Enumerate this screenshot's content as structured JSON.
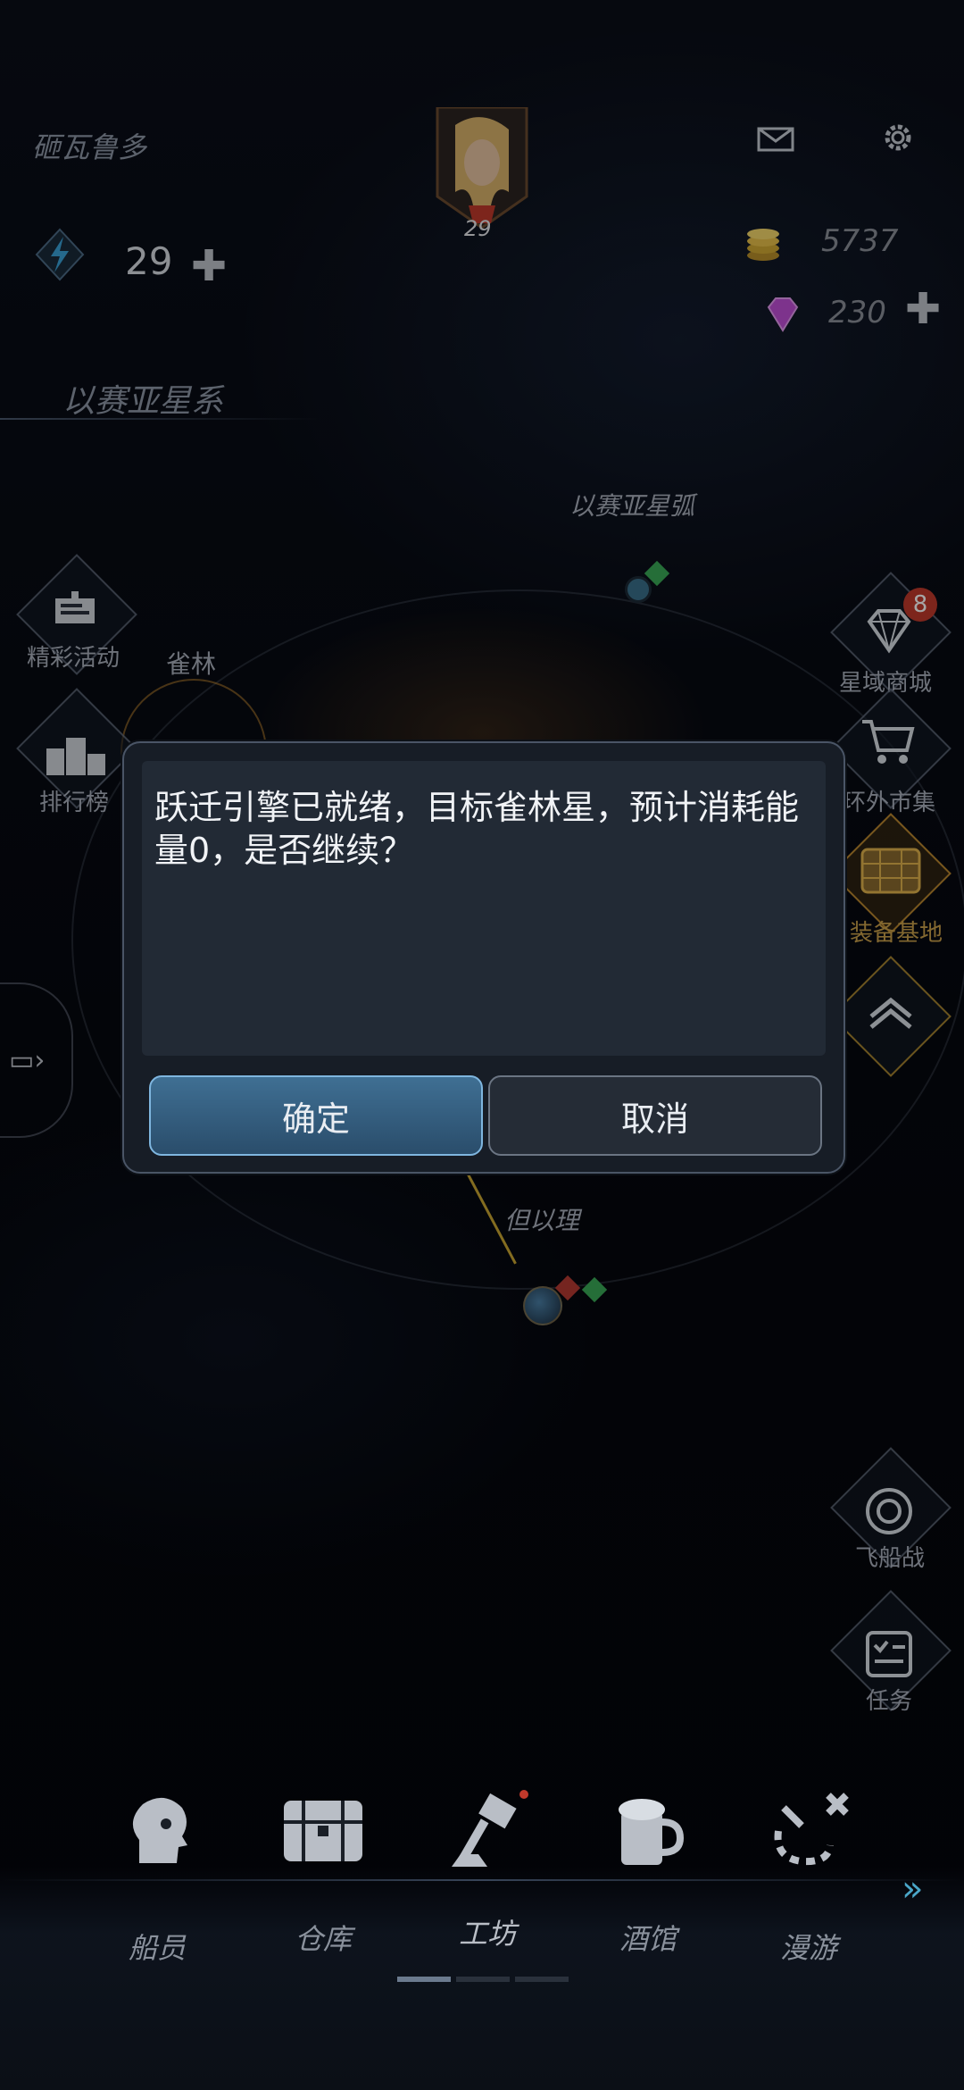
{
  "header": {
    "player_name": "砸瓦鲁多",
    "level": "29",
    "energy": "29",
    "gold": "5737",
    "gems": "230"
  },
  "map": {
    "system_name": "以赛亚星系",
    "arc_label": "以赛亚星弧",
    "planet_1": "雀林",
    "planet_2": "但以理"
  },
  "left_menu": [
    {
      "label": "精彩活动"
    },
    {
      "label": "排行榜"
    }
  ],
  "right_menu": [
    {
      "label": "星域商城",
      "badge": "8"
    },
    {
      "label": "环外市集"
    },
    {
      "label": "装备基地"
    },
    {
      "label": "飞船战"
    },
    {
      "label": "任务"
    }
  ],
  "dialog": {
    "message": "跃迁引擎已就绪，目标雀林星，预计消耗能量0，是否继续？",
    "confirm": "确定",
    "cancel": "取消"
  },
  "bottom_nav": [
    {
      "label": "船员"
    },
    {
      "label": "仓库"
    },
    {
      "label": "工坊"
    },
    {
      "label": "酒馆"
    },
    {
      "label": "漫游"
    }
  ],
  "colors": {
    "confirm_button": "#2f5a7c",
    "dialog_bg": "#171d26",
    "badge": "#c0392b"
  }
}
